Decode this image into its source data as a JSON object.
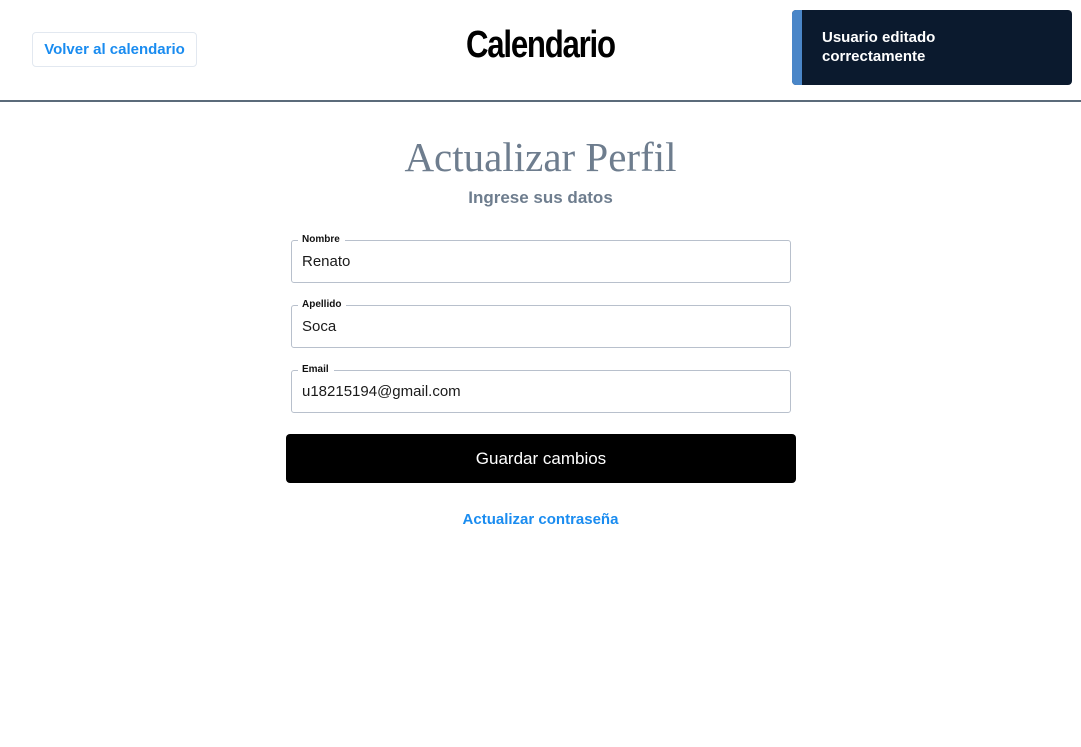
{
  "header": {
    "back_label": "Volver al calendario",
    "app_title": "Calendario"
  },
  "toast": {
    "message": "Usuario editado correctamente"
  },
  "form": {
    "heading": "Actualizar Perfil",
    "subtitle": "Ingrese sus datos",
    "fields": [
      {
        "label": "Nombre",
        "value": "Renato"
      },
      {
        "label": "Apellido",
        "value": "Soca"
      },
      {
        "label": "Email",
        "value": "u18215194@gmail.com"
      }
    ],
    "save_label": "Guardar cambios",
    "password_link": "Actualizar contraseña"
  },
  "colors": {
    "accent_link": "#1a8cf0",
    "toast_bg": "#0b1a2e",
    "toast_bar": "#4a86c8",
    "heading": "#6e7d8e"
  }
}
